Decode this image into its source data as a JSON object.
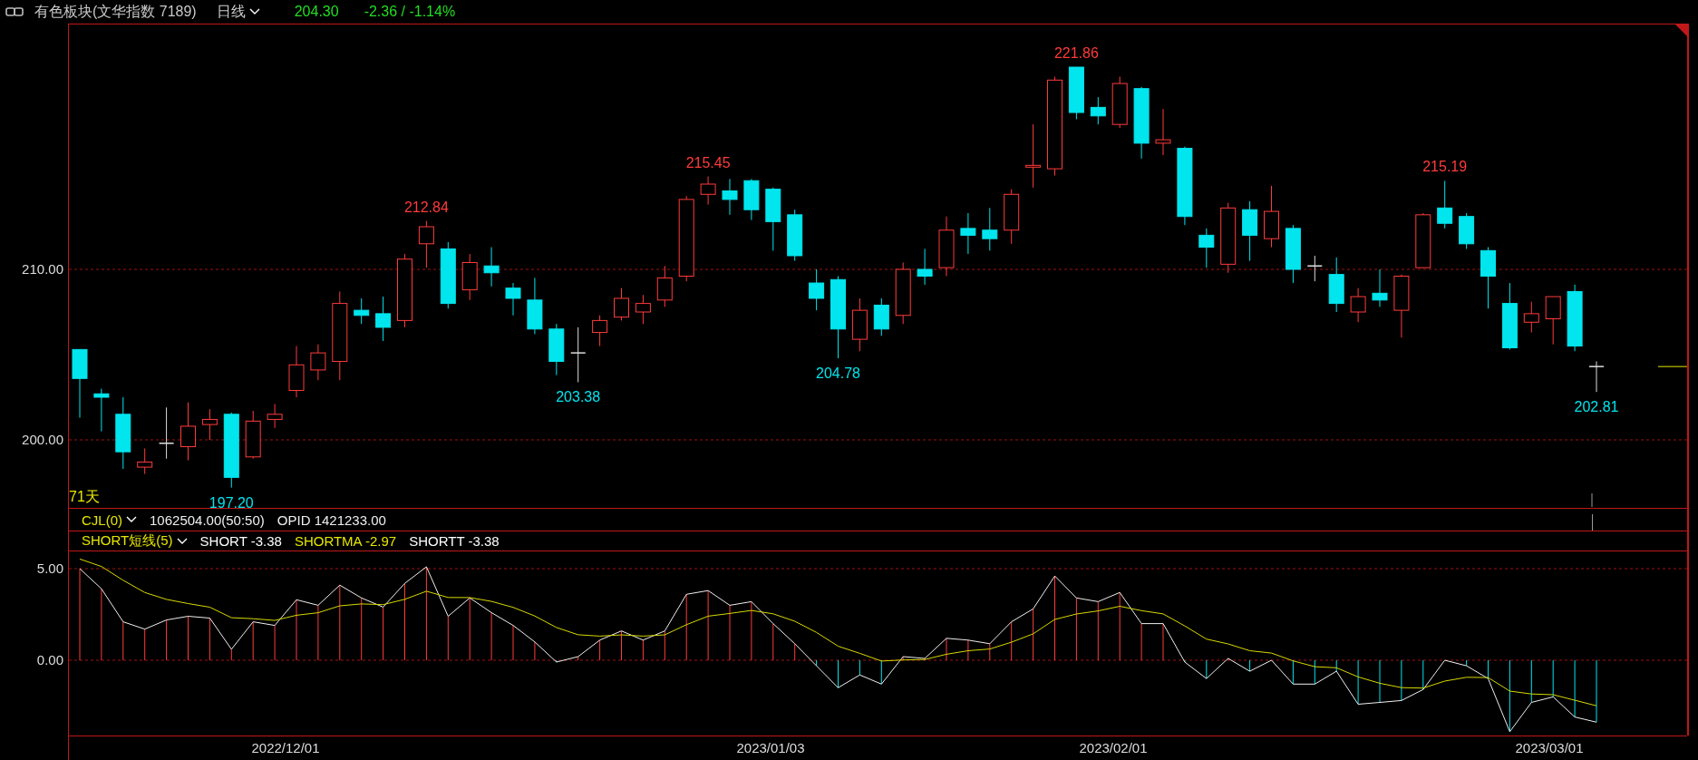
{
  "header": {
    "title": "有色板块(文华指数 7189)",
    "period": "日线",
    "price": "204.30",
    "change": "-2.36 / -1.14%"
  },
  "main_chart": {
    "y_labels": [
      "210.00",
      "200.00"
    ],
    "day_count": "71天",
    "annotations": [
      {
        "kind": "low",
        "text": "197.20"
      },
      {
        "kind": "high",
        "text": "212.84"
      },
      {
        "kind": "low",
        "text": "203.38"
      },
      {
        "kind": "high",
        "text": "215.45"
      },
      {
        "kind": "low",
        "text": "204.78"
      },
      {
        "kind": "high",
        "text": "221.86"
      },
      {
        "kind": "high",
        "text": "215.19"
      },
      {
        "kind": "low",
        "text": "202.81"
      }
    ]
  },
  "volume_bar": {
    "name": "CJL(0)",
    "value": "1062504.00(50:50)",
    "opid": "OPID 1421233.00"
  },
  "indicator": {
    "name": "SHORT短线(5)",
    "y_labels": [
      "5.00",
      "0.00"
    ],
    "legend": [
      {
        "label": "SHORT -3.38",
        "color": "#ffffff"
      },
      {
        "label": "SHORTMA -2.97",
        "color": "#e6e600"
      },
      {
        "label": "SHORTT -3.38",
        "color": "#ffffff"
      }
    ]
  },
  "x_axis": [
    "2022/12/01",
    "2023/01/03",
    "2023/02/01",
    "2023/03/01"
  ]
}
